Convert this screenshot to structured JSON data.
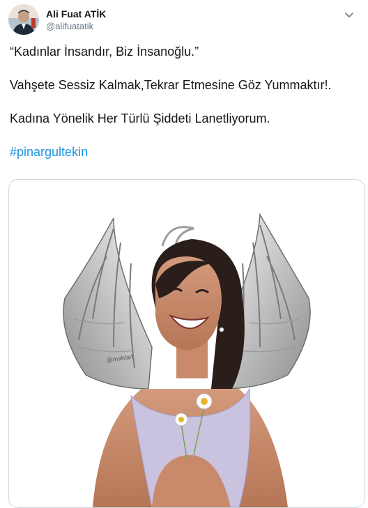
{
  "tweet": {
    "author": {
      "display_name": "Ali Fuat ATİK",
      "handle": "@alifuatatik"
    },
    "lines": [
      "“Kadınlar İnsandır, Biz İnsanoğlu.”",
      "Vahşete Sessiz Kalmak,Tekrar Etmesine Göz Yummaktır!.",
      "Kadına Yönelik Her Türlü Şiddeti Lanetliyorum."
    ],
    "hashtag": "#pinargultekin",
    "media": {
      "signature": "@mahlart"
    }
  },
  "colors": {
    "link": "#1b95e0",
    "text": "#14171a",
    "muted": "#657786",
    "border": "#ccd6dd"
  }
}
